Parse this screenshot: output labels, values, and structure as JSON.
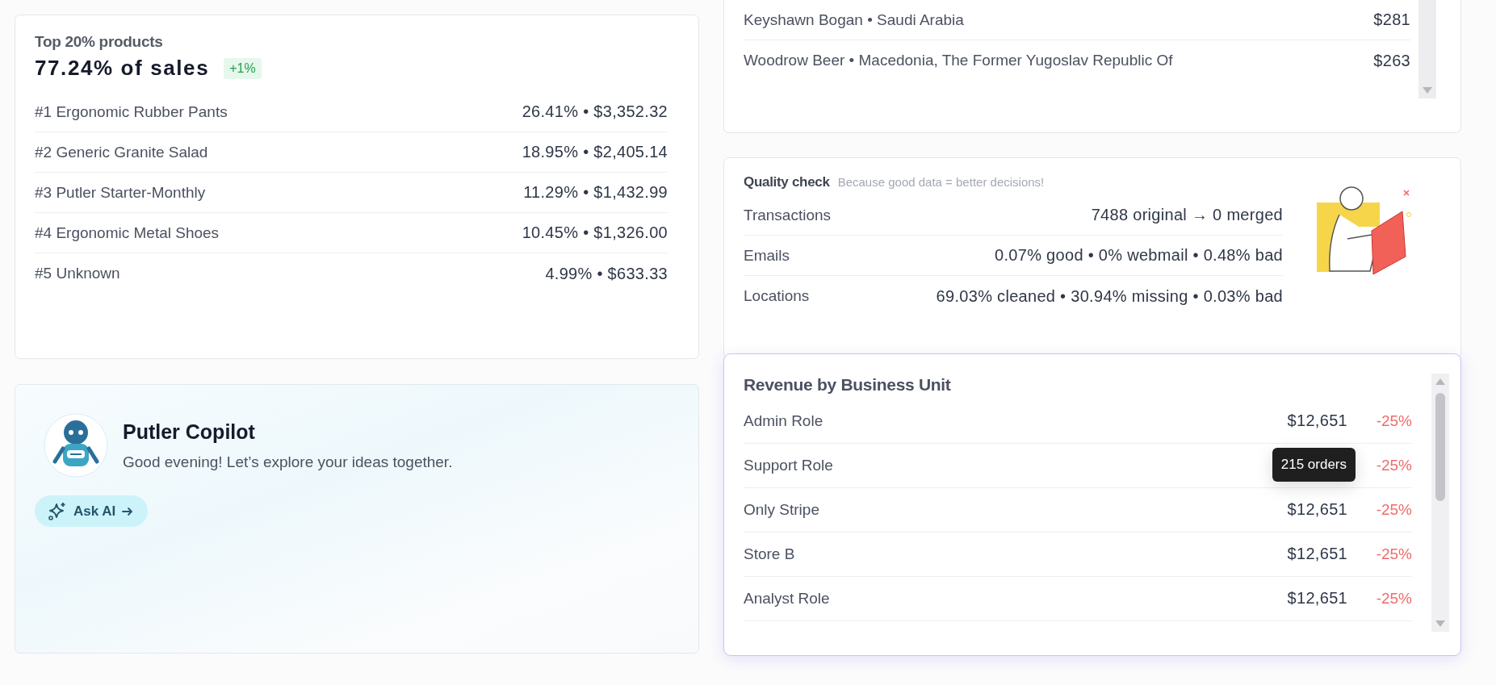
{
  "top_products": {
    "title": "Top 20% products",
    "headline": "77.24% of sales",
    "badge": "+1%",
    "items": [
      {
        "name": "#1 Ergonomic Rubber Pants",
        "value": "26.41% • $3,352.32"
      },
      {
        "name": "#2 Generic Granite Salad",
        "value": "18.95% • $2,405.14"
      },
      {
        "name": "#3 Putler Starter-Monthly",
        "value": "11.29% • $1,432.99"
      },
      {
        "name": "#4 Ergonomic Metal Shoes",
        "value": "10.45% • $1,326.00"
      },
      {
        "name": "#5 Unknown",
        "value": "4.99% • $633.33"
      }
    ]
  },
  "top_customers": {
    "rows": [
      {
        "name": "Keyshawn Bogan • Saudi Arabia",
        "amount": "$281"
      },
      {
        "name": "Woodrow Beer • Macedonia, The Former Yugoslav Republic Of",
        "amount": "$263"
      }
    ]
  },
  "quality_check": {
    "title": "Quality check",
    "subtitle": "Because good data = better decisions!",
    "rows": [
      {
        "label": "Transactions",
        "value": "7488 original → 0 merged"
      },
      {
        "label": "Emails",
        "value": "0.07% good • 0% webmail • 0.48% bad"
      },
      {
        "label": "Locations",
        "value": "69.03% cleaned • 30.94% missing • 0.03% bad"
      }
    ]
  },
  "copilot": {
    "title": "Putler Copilot",
    "greeting": "Good evening! Let’s explore your ideas together.",
    "button": "Ask AI"
  },
  "revenue": {
    "title": "Revenue by Business Unit",
    "rows": [
      {
        "name": "Admin Role",
        "amount": "$12,651",
        "change": "-25%"
      },
      {
        "name": "Support Role",
        "tooltip": "215 orders",
        "change": "-25%"
      },
      {
        "name": "Only Stripe",
        "amount": "$12,651",
        "change": "-25%"
      },
      {
        "name": "Store B",
        "amount": "$12,651",
        "change": "-25%"
      },
      {
        "name": "Analyst Role",
        "amount": "$12,651",
        "change": "-25%"
      }
    ]
  }
}
